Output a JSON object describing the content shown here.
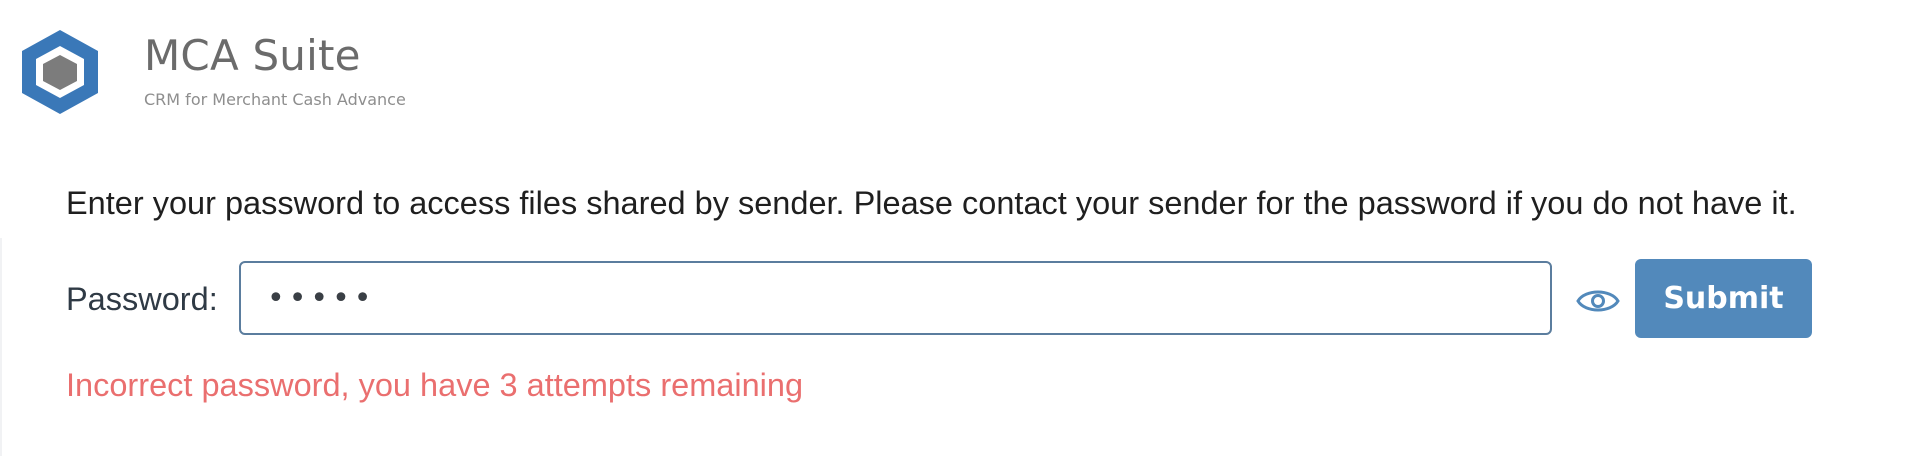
{
  "brand": {
    "title": "MCA Suite",
    "subtitle": "CRM for Merchant Cash Advance",
    "logo_icon": "hexagon-logo-icon",
    "logo_colors": {
      "outer": "#3a78b8",
      "inner": "#7c7c7c"
    }
  },
  "instructions": "Enter your password to access files shared by sender. Please contact your sender for the password if you do not have it.",
  "password_form": {
    "label": "Password:",
    "value": "•••••",
    "reveal_icon": "eye-icon",
    "submit_label": "Submit"
  },
  "error": {
    "message": "Incorrect password, you have 3 attempts remaining",
    "color": "#ea6f6f"
  },
  "colors": {
    "accent": "#5289bb",
    "input_border": "#5b7d9e"
  }
}
